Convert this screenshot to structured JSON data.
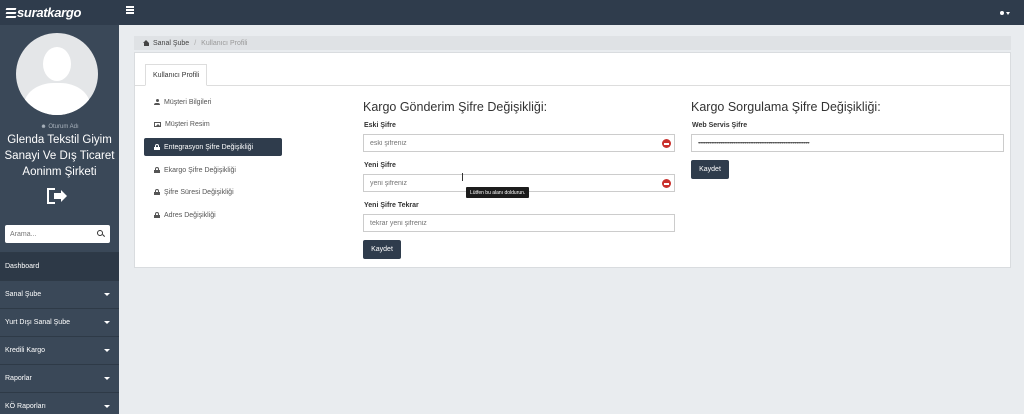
{
  "brand": "suratkargo",
  "sidebar": {
    "user_label": "Oturum Adı",
    "user_name_lines": [
      "Glenda Tekstil Giyim",
      "Sanayi Ve Dış Ticaret",
      "Aoninm Şirketi"
    ],
    "search_placeholder": "Arama...",
    "nav": [
      {
        "label": "Dashboard"
      },
      {
        "label": "Sanal Şube"
      },
      {
        "label": "Yurt Dışı Sanal Şube"
      },
      {
        "label": "Kredili Kargo"
      },
      {
        "label": "Raporlar"
      },
      {
        "label": "KÖ Raporları"
      }
    ]
  },
  "breadcrumb": {
    "root": "Sanal Şube",
    "separator": "/",
    "current": "Kullanıcı Profili"
  },
  "tab": "Kullanıcı Profili",
  "menu": [
    {
      "label": "Müşteri Bilgileri",
      "icon": "user-icon"
    },
    {
      "label": "Müşteri Resim",
      "icon": "image-icon"
    },
    {
      "label": "Entegrasyon Şifre Değişikliği",
      "icon": "lock-icon"
    },
    {
      "label": "Ekargo Şifre Değişikliği",
      "icon": "lock-icon"
    },
    {
      "label": "Şifre Süresi Değişikliği",
      "icon": "lock-icon"
    },
    {
      "label": "Adres Değişikliği",
      "icon": "lock-icon"
    }
  ],
  "shipment_form": {
    "title": "Kargo Gönderim Şifre Değişikliği:",
    "old_label": "Eski Şifre",
    "old_placeholder": "eski şifreniz",
    "new_label": "Yeni Şifre",
    "new_placeholder": "yeni şifreniz",
    "repeat_label": "Yeni Şifre Tekrar",
    "repeat_placeholder": "tekrar yeni şifreniz",
    "save": "Kaydet",
    "tooltip": "Lütfen bu alanı doldurun."
  },
  "query_form": {
    "title": "Kargo Sorgulama Şifre Değişikliği:",
    "ws_label": "Web Servis Şifre",
    "ws_value": "••••••••••••••••••••••••••••••••••••••••••••••••••••••••••••",
    "save": "Kaydet"
  },
  "colors": {
    "topbar": "#2f3c4c",
    "sidebar": "#3a4858",
    "button": "#2f3c4c",
    "key_icon": "#c9302c"
  }
}
